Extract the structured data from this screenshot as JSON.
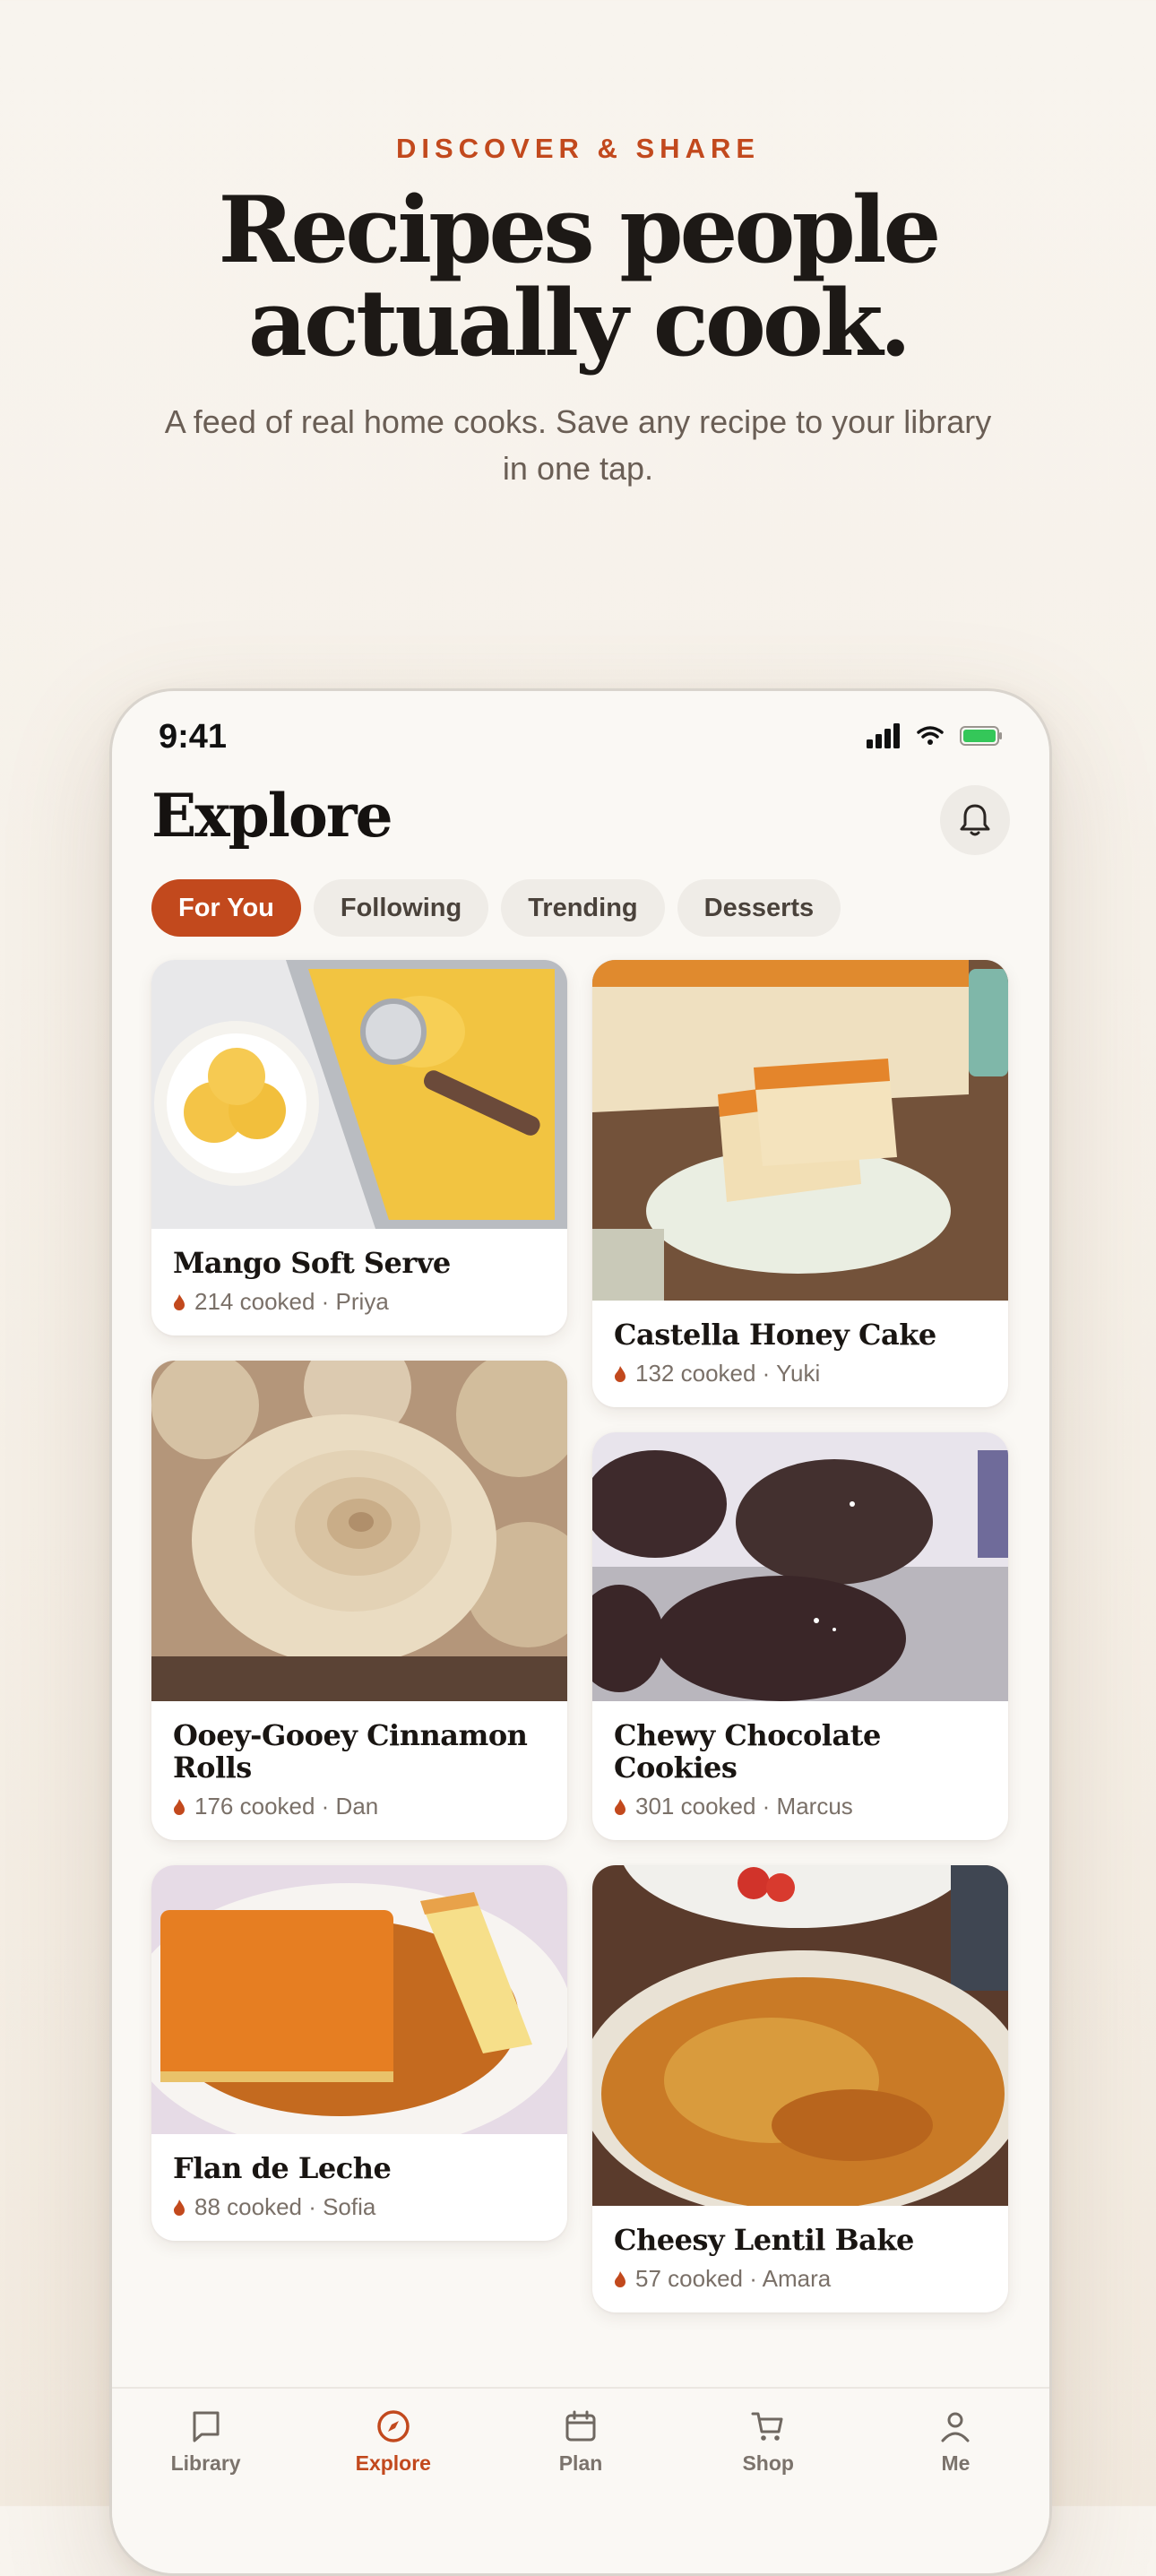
{
  "hero": {
    "eyebrow": "DISCOVER & SHARE",
    "headline_line1": "Recipes people",
    "headline_line2": "actually cook.",
    "subhead": "A feed of real home cooks. Save any recipe to your library in one tap."
  },
  "status_bar": {
    "time": "9:41"
  },
  "header": {
    "title": "Explore",
    "bell_icon": "bell-icon"
  },
  "chips": [
    {
      "label": "For You",
      "active": true
    },
    {
      "label": "Following",
      "active": false
    },
    {
      "label": "Trending",
      "active": false
    },
    {
      "label": "Desserts",
      "active": false
    }
  ],
  "recipes_left": [
    {
      "title": "Mango Soft Serve",
      "meta": "214 cooked · Priya"
    },
    {
      "title": "Ooey-Gooey Cinnamon Rolls",
      "meta": "176 cooked · Dan"
    },
    {
      "title": "Flan de Leche",
      "meta": "88 cooked · Sofia"
    }
  ],
  "recipes_right": [
    {
      "title": "Castella Honey Cake",
      "meta": "132 cooked · Yuki"
    },
    {
      "title": "Chewy Chocolate Cookies",
      "meta": "301 cooked · Marcus"
    },
    {
      "title": "Cheesy Lentil Bake",
      "meta": "57 cooked · Amara"
    }
  ],
  "tabbar": [
    {
      "label": "Library",
      "icon": "book-icon"
    },
    {
      "label": "Explore",
      "icon": "compass-icon",
      "active": true
    },
    {
      "label": "Plan",
      "icon": "calendar-icon"
    },
    {
      "label": "Shop",
      "icon": "cart-icon"
    },
    {
      "label": "Me",
      "icon": "person-icon"
    }
  ],
  "colors": {
    "accent": "#c2491d",
    "background": "#f8f4ee",
    "card": "#ffffff"
  }
}
